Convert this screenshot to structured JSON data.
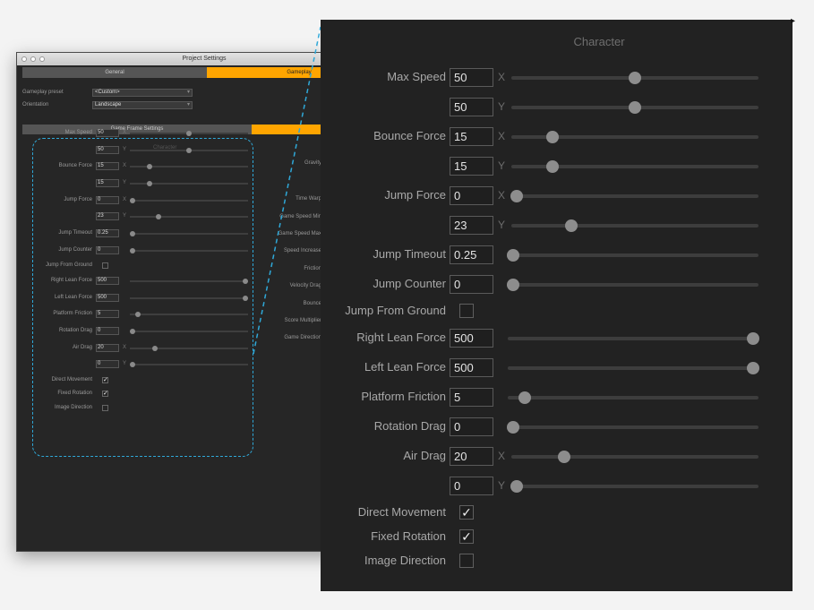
{
  "mini_window": {
    "title": "Project Settings",
    "tabs": [
      {
        "label": "General",
        "active": false
      },
      {
        "label": "Gameplay",
        "active": true
      }
    ],
    "gameplay_preset_label": "Gameplay preset",
    "gameplay_preset_value": "<Custom>",
    "orientation_label": "Orientation",
    "orientation_value": "Landscape",
    "subtabs": [
      {
        "label": "Game Frame Settings",
        "active": false
      },
      {
        "label": "",
        "active": true
      }
    ],
    "section_title": "Character",
    "right_labels": [
      "Gravity",
      "Time Warp",
      "Game Speed Min",
      "Game Speed Max",
      "Speed Increase",
      "Friction",
      "Velocity Drag",
      "Bounce",
      "Score Multiplier",
      "Game Direction"
    ]
  },
  "panel": {
    "section_title": "Character",
    "rows": [
      {
        "kind": "slider",
        "label": "Max Speed",
        "value": "50",
        "axis": "X",
        "level": 0.5
      },
      {
        "kind": "slider",
        "label": "",
        "value": "50",
        "axis": "Y",
        "level": 0.5
      },
      {
        "kind": "slider",
        "label": "Bounce Force",
        "value": "15",
        "axis": "X",
        "level": 0.15
      },
      {
        "kind": "slider",
        "label": "",
        "value": "15",
        "axis": "Y",
        "level": 0.15
      },
      {
        "kind": "slider",
        "label": "Jump Force",
        "value": "0",
        "axis": "X",
        "level": 0.0
      },
      {
        "kind": "slider",
        "label": "",
        "value": "23",
        "axis": "Y",
        "level": 0.23
      },
      {
        "kind": "slider",
        "label": "Jump Timeout",
        "value": "0.25",
        "axis": "",
        "level": 0.0
      },
      {
        "kind": "slider",
        "label": "Jump Counter",
        "value": "0",
        "axis": "",
        "level": 0.0
      },
      {
        "kind": "check",
        "label": "Jump From Ground",
        "checked": false
      },
      {
        "kind": "slider",
        "label": "Right Lean Force",
        "value": "500",
        "axis": "",
        "level": 1.0
      },
      {
        "kind": "slider",
        "label": "Left Lean Force",
        "value": "500",
        "axis": "",
        "level": 1.0
      },
      {
        "kind": "slider",
        "label": "Platform Friction",
        "value": "5",
        "axis": "",
        "level": 0.05
      },
      {
        "kind": "slider",
        "label": "Rotation Drag",
        "value": "0",
        "axis": "",
        "level": 0.0
      },
      {
        "kind": "slider",
        "label": "Air Drag",
        "value": "20",
        "axis": "X",
        "level": 0.2
      },
      {
        "kind": "slider",
        "label": "",
        "value": "0",
        "axis": "Y",
        "level": 0.0
      },
      {
        "kind": "check",
        "label": "Direct Movement",
        "checked": true
      },
      {
        "kind": "check",
        "label": "Fixed Rotation",
        "checked": true
      },
      {
        "kind": "check",
        "label": "Image Direction",
        "checked": false
      }
    ],
    "check_glyph": "✓"
  }
}
